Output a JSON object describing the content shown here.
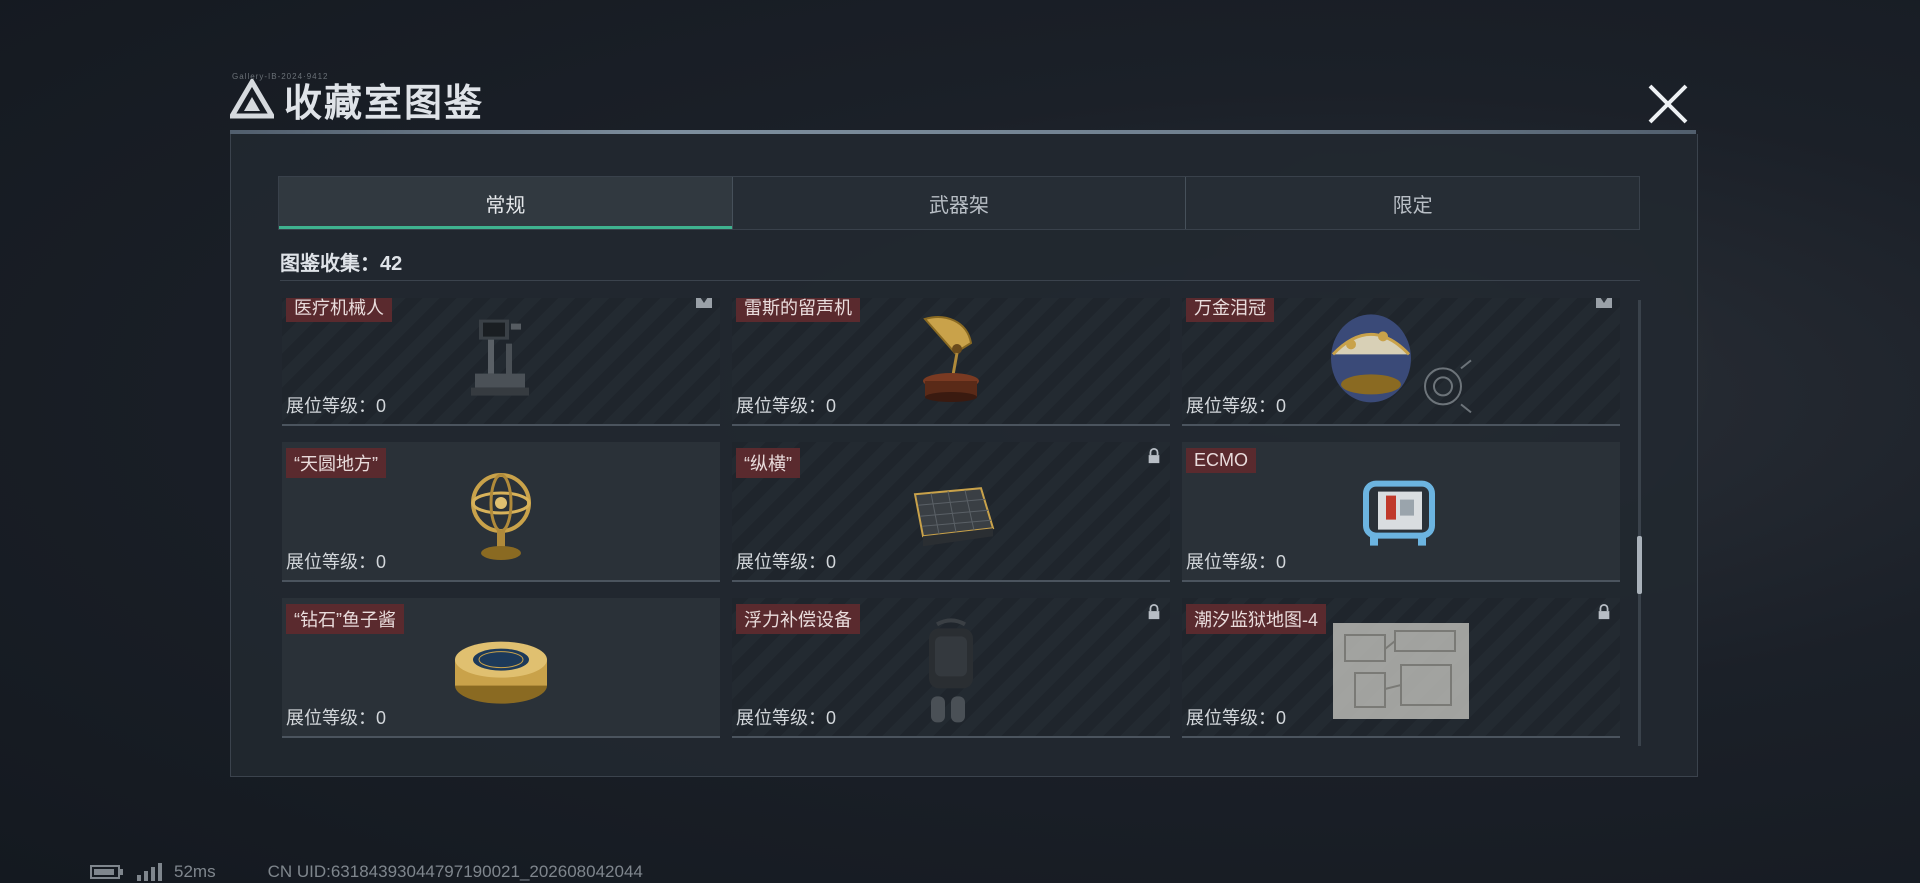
{
  "header": {
    "title": "收藏室图鉴",
    "code": "Gallery-IB-2024·9412"
  },
  "tabs": [
    {
      "label": "常规",
      "active": true
    },
    {
      "label": "武器架",
      "active": false
    },
    {
      "label": "限定",
      "active": false
    }
  ],
  "collection": {
    "label": "图鉴收集：",
    "count": "42"
  },
  "cards": [
    {
      "name": "医疗机械人",
      "level_label": "展位等级：",
      "level": "0",
      "badge": "triangle-down",
      "icon": "robot-icon"
    },
    {
      "name": "雷斯的留声机",
      "level_label": "展位等级：",
      "level": "0",
      "badge": "",
      "icon": "gramophone-icon"
    },
    {
      "name": "万金泪冠",
      "level_label": "展位等级：",
      "level": "0",
      "badge": "triangle-down",
      "icon": "jeweled-egg-icon"
    },
    {
      "name": "“天圆地方”",
      "level_label": "展位等级：",
      "level": "0",
      "badge": "",
      "icon": "armillary-sphere-icon"
    },
    {
      "name": "“纵横”",
      "level_label": "展位等级：",
      "level": "0",
      "badge": "lock",
      "icon": "chessboard-icon"
    },
    {
      "name": "ECMO",
      "level_label": "展位等级：",
      "level": "0",
      "badge": "",
      "icon": "ecmo-machine-icon"
    },
    {
      "name": "“钻石”鱼子酱",
      "level_label": "展位等级：",
      "level": "0",
      "badge": "",
      "icon": "caviar-tin-icon"
    },
    {
      "name": "浮力补偿设备",
      "level_label": "展位等级：",
      "level": "0",
      "badge": "lock",
      "icon": "buoyancy-device-icon"
    },
    {
      "name": "潮汐监狱地图-4",
      "level_label": "展位等级：",
      "level": "0",
      "badge": "lock",
      "icon": "map-icon"
    }
  ],
  "status": {
    "ping": "52ms",
    "uid": "CN UID:63184393044797190021_202608042044"
  },
  "colors": {
    "accent": "#3fb28f",
    "name_tag": "#5a2a2e",
    "gold": "#c9a24a"
  }
}
